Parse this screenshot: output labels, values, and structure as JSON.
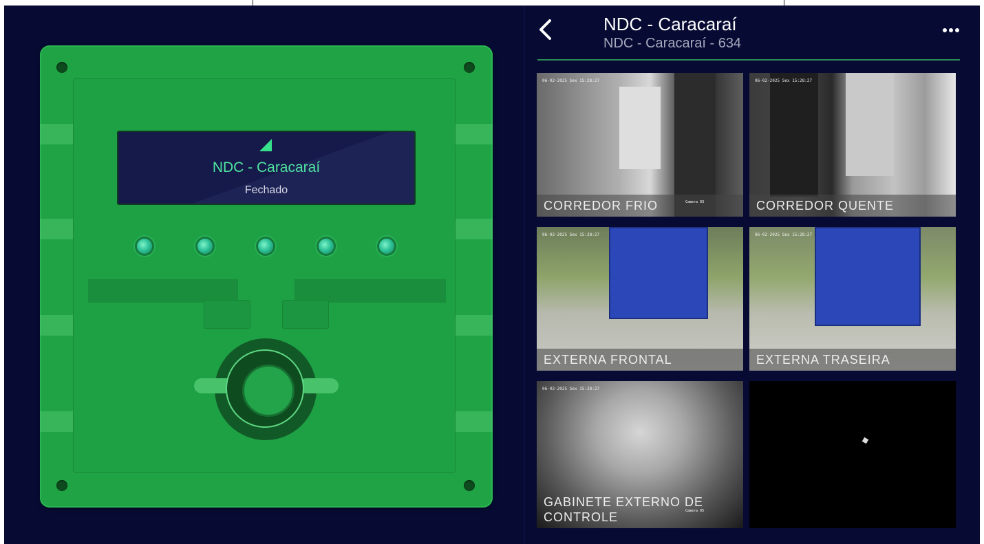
{
  "device": {
    "site_name": "NDC - Caracaraí",
    "status": "Fechado",
    "led_count": 5,
    "colors": {
      "panel": "#1fa345",
      "display_text": "#4ee5a0",
      "led": "#2fc39a"
    }
  },
  "header": {
    "title": "NDC - Caracaraí",
    "subtitle": "NDC - Caracaraí - 634",
    "back_icon": "chevron-left-icon",
    "menu_icon": "more-horizontal-icon"
  },
  "cameras": [
    {
      "label": "CORREDOR FRIO",
      "timestamp": "06-02-2025 Sex 15:28:27",
      "tag": "Camera 03"
    },
    {
      "label": "CORREDOR QUENTE",
      "timestamp": "06-02-2025 Sex 15:28:27"
    },
    {
      "label": "EXTERNA FRONTAL",
      "timestamp": "06-02-2025 Sex 15:28:27"
    },
    {
      "label": "EXTERNA TRASEIRA",
      "timestamp": "06-02-2025 Sex 15:28:27"
    },
    {
      "label": "GABINETE EXTERNO DE CONTROLE",
      "timestamp": "06-02-2025 Sex 15:28:27",
      "tag": "Camera 05"
    },
    {
      "label": ""
    }
  ],
  "colors": {
    "background": "#070b33",
    "accent_line": "#2c8a55"
  }
}
